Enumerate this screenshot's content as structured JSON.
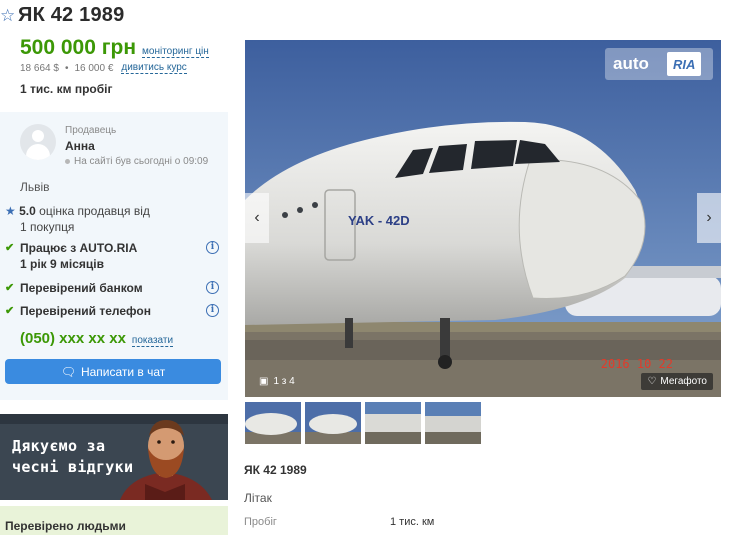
{
  "listing": {
    "title": "ЯК 42 1989",
    "price": "500 000 грн",
    "price_monitor_link": "моніторинг цін",
    "price_usd": "18 664 $",
    "price_eur": "16 000 €",
    "rate_link": "дивитись курс",
    "mileage": "1 тис. км пробіг"
  },
  "seller": {
    "label": "Продавець",
    "name": "Анна",
    "online": "На сайті був сьогодні о 09:09",
    "city": "Львів",
    "rating_value": "5.0",
    "rating_text": "оцінка продавця від",
    "purchases": "1 покупця",
    "works_with": "Працює з AUTO.RIA",
    "works_duration": "1 рік 9 місяців",
    "bank_verified": "Перевірений банком",
    "phone_verified": "Перевірений телефон",
    "phone": "(050) xxx xx xx",
    "show_phone": "показати",
    "chat_button": "Написати в чат"
  },
  "banner": {
    "line1": "Дякуємо за",
    "line2": "чесні відгуки"
  },
  "verified": "Перевірено людьми",
  "gallery": {
    "logo_left": "auto",
    "logo_right": "RIA",
    "counter": "1 з 4",
    "mega_photo": "Мегафото",
    "aircraft_label": "YAK - 42D",
    "date_stamp": "2016 10 22"
  },
  "details": {
    "title": "ЯК 42 1989",
    "type": "Літак",
    "mileage_key": "Пробіг",
    "mileage_value": "1 тис. км"
  },
  "colors": {
    "price_green": "#3c9806",
    "link_blue": "#256799",
    "chat_blue": "#3a8be0",
    "card_bg": "#f2f7fb"
  }
}
